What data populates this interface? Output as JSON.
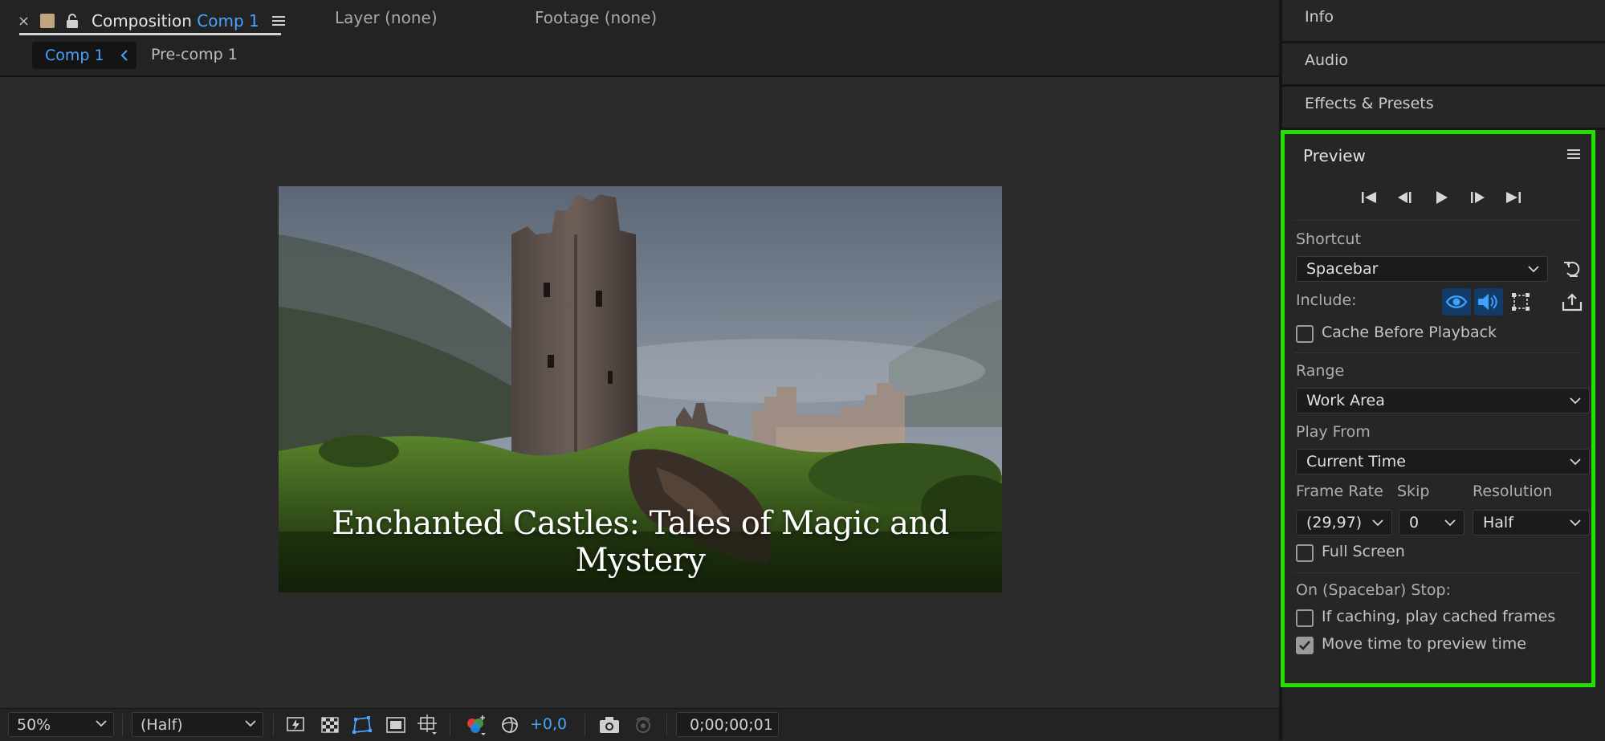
{
  "composition_panel": {
    "tab": {
      "prefix": "Composition",
      "name": "Comp 1"
    },
    "other_tabs": {
      "layer": "Layer (none)",
      "footage": "Footage (none)"
    },
    "breadcrumbs": [
      "Comp 1",
      "Pre-comp 1"
    ],
    "frame_title": "Enchanted Castles: Tales of Magic and Mystery",
    "bottom_bar": {
      "zoom": "50%",
      "resolution": "(Half)",
      "exposure": "+0,0",
      "timecode": "0;00;00;01",
      "icons": [
        "fast-previews-icon",
        "transparency-grid-icon",
        "mask-visibility-icon",
        "region-of-interest-icon",
        "grid-guides-icon",
        "color-channel-icon",
        "reset-exposure-icon",
        "snapshot-icon",
        "show-snapshot-icon"
      ]
    }
  },
  "right_panels": {
    "info": "Info",
    "audio": "Audio",
    "effects": "Effects & Presets",
    "preview": {
      "title": "Preview",
      "transport_icons": [
        "first-frame-icon",
        "previous-frame-icon",
        "play-icon",
        "next-frame-icon",
        "last-frame-icon"
      ],
      "shortcut_label": "Shortcut",
      "shortcut_value": "Spacebar",
      "include_label": "Include:",
      "include_video_on": true,
      "include_audio_on": true,
      "include_overlays_on": false,
      "cache_before_playback": {
        "label": "Cache Before Playback",
        "checked": false
      },
      "range_label": "Range",
      "range_value": "Work Area",
      "play_from_label": "Play From",
      "play_from_value": "Current Time",
      "frame_rate_label": "Frame Rate",
      "frame_rate_value": "(29,97)",
      "skip_label": "Skip",
      "skip_value": "0",
      "resolution_label": "Resolution",
      "resolution_value": "Half",
      "full_screen": {
        "label": "Full Screen",
        "checked": false
      },
      "on_stop_label": "On (Spacebar) Stop:",
      "if_caching": {
        "label": "If caching, play cached frames",
        "checked": false
      },
      "move_time": {
        "label": "Move time to preview time",
        "checked": true
      }
    }
  },
  "colors": {
    "accent": "#4aa3ff",
    "highlight_box": "#22e000",
    "panel_bg": "#232323",
    "viewer_bg": "#2b2b2b"
  }
}
